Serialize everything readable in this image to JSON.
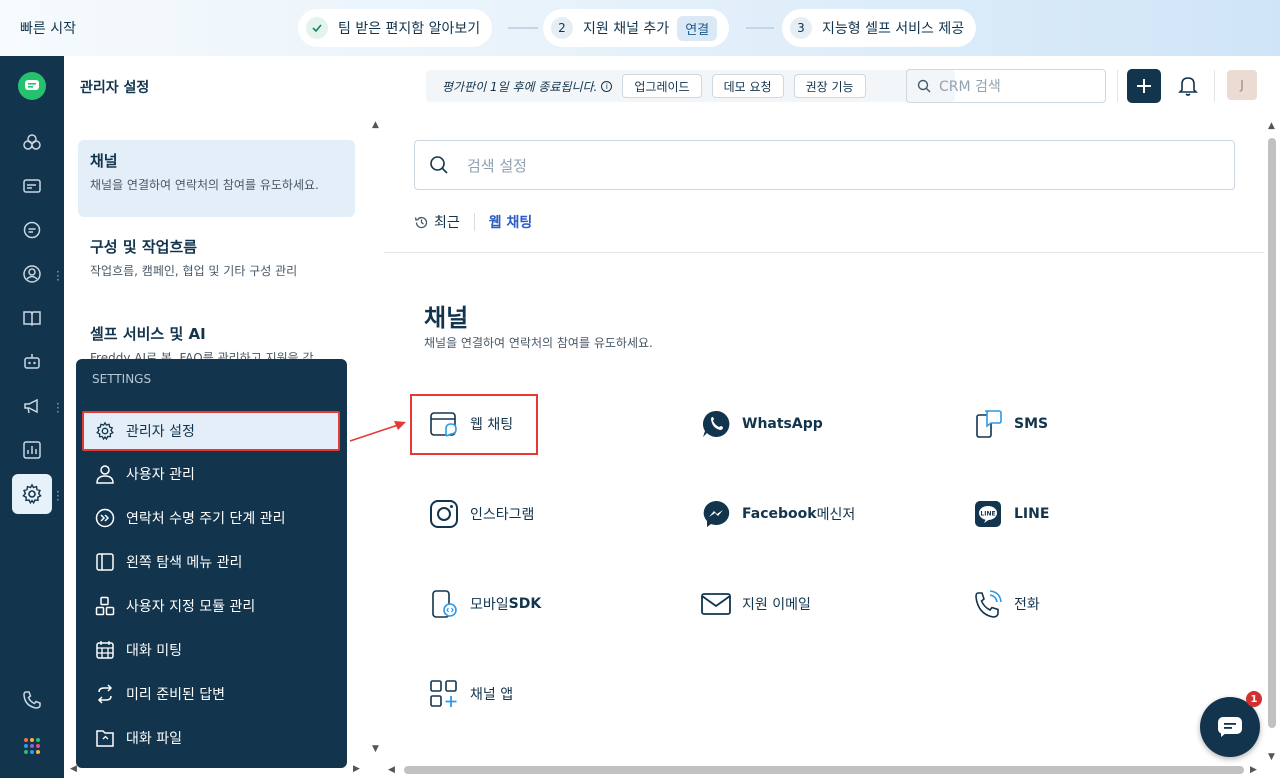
{
  "quickstart": {
    "label": "빠른 시작",
    "steps": [
      {
        "num": "",
        "label": "팀 받은 편지함 알아보기"
      },
      {
        "num": "2",
        "label": "지원 채널 추가",
        "tag": "연결"
      },
      {
        "num": "3",
        "label": "지능형 셀프 서비스 제공"
      }
    ]
  },
  "header": {
    "title": "관리자 설정",
    "trial_text": "평가판이 1일 후에 종료됩니다.",
    "trial_info": "i",
    "buttons": [
      "업그레이드",
      "데모 요청",
      "권장 기능"
    ],
    "crm_placeholder": "CRM 검색",
    "avatar": "J"
  },
  "settings_sections": [
    {
      "title": "채널",
      "desc": "채널을 연결하여 연락처의 참여를 유도하세요."
    },
    {
      "title": "구성 및 작업흐름",
      "desc": "작업흐름, 캠페인, 협업 및 기타 구성 관리"
    },
    {
      "title": "셀프 서비스 및 AI",
      "desc": "Freddy AI로 봇, FAQ를 관리하고 지원을 강"
    }
  ],
  "dropdown": {
    "caption": "SETTINGS",
    "items": [
      "관리자 설정",
      "사용자 관리",
      "연락처 수명 주기 단계 관리",
      "왼쪽 탐색 메뉴 관리",
      "사용자 지정 모듈 관리",
      "대화 미팅",
      "미리 준비된 답변",
      "대화 파일"
    ]
  },
  "main": {
    "search_placeholder": "검색 설정",
    "recent_label": "최근",
    "recent_link": "웹 채팅",
    "title": "채널",
    "desc": "채널을 연결하여 연락처의 참여를 유도하세요.",
    "channels": [
      {
        "label": "웹 채팅"
      },
      {
        "label": "WhatsApp"
      },
      {
        "label": "SMS"
      },
      {
        "label": "인스타그램"
      },
      {
        "label": "Facebook",
        "label2": " 메신저"
      },
      {
        "label": "LINE"
      },
      {
        "label": "모바일",
        "label2": " SDK"
      },
      {
        "label": "지원 이메일"
      },
      {
        "label": "전화"
      },
      {
        "label": "채널 앱"
      }
    ]
  },
  "chat_badge": "1",
  "colors": {
    "navy": "#12344d",
    "accent": "#2c5cc5",
    "highlight": "#e53935"
  }
}
